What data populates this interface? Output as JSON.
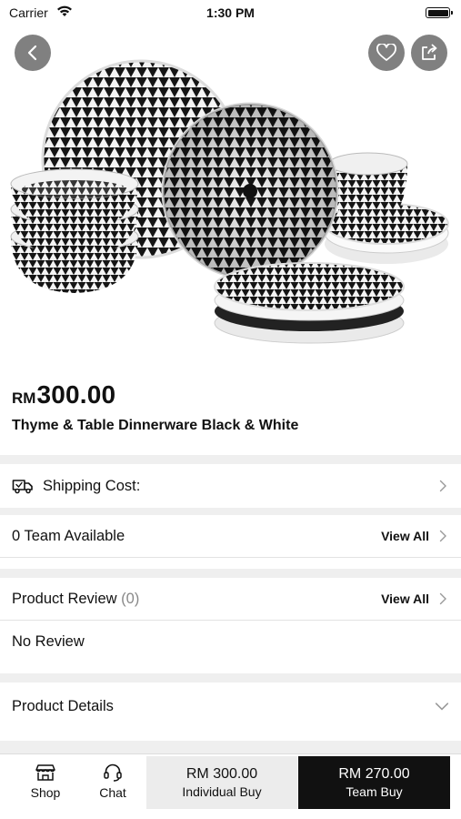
{
  "status_bar": {
    "carrier": "Carrier",
    "time": "1:30 PM"
  },
  "product": {
    "currency": "RM",
    "price": "300.00",
    "title": "Thyme & Table Dinnerware Black & White"
  },
  "sections": {
    "shipping_label": "Shipping Cost:",
    "team_label": "0 Team Available",
    "team_view_all": "View All",
    "review_label": "Product Review",
    "review_count": "(0)",
    "review_view_all": "View All",
    "no_review": "No Review",
    "details_label": "Product Details"
  },
  "bottom_bar": {
    "shop_label": "Shop",
    "chat_label": "Chat",
    "individual_price": "RM 300.00",
    "individual_label": "Individual Buy",
    "team_price": "RM 270.00",
    "team_label": "Team Buy"
  },
  "icons": {
    "back": "chevron-left-icon",
    "favorite": "heart-icon",
    "share": "share-icon",
    "shipping": "truck-icon",
    "shop": "store-icon",
    "chat": "headset-icon"
  },
  "colors": {
    "circle_button": "#808080",
    "team_buy_bg": "#111111",
    "individual_buy_bg": "#ececec"
  }
}
